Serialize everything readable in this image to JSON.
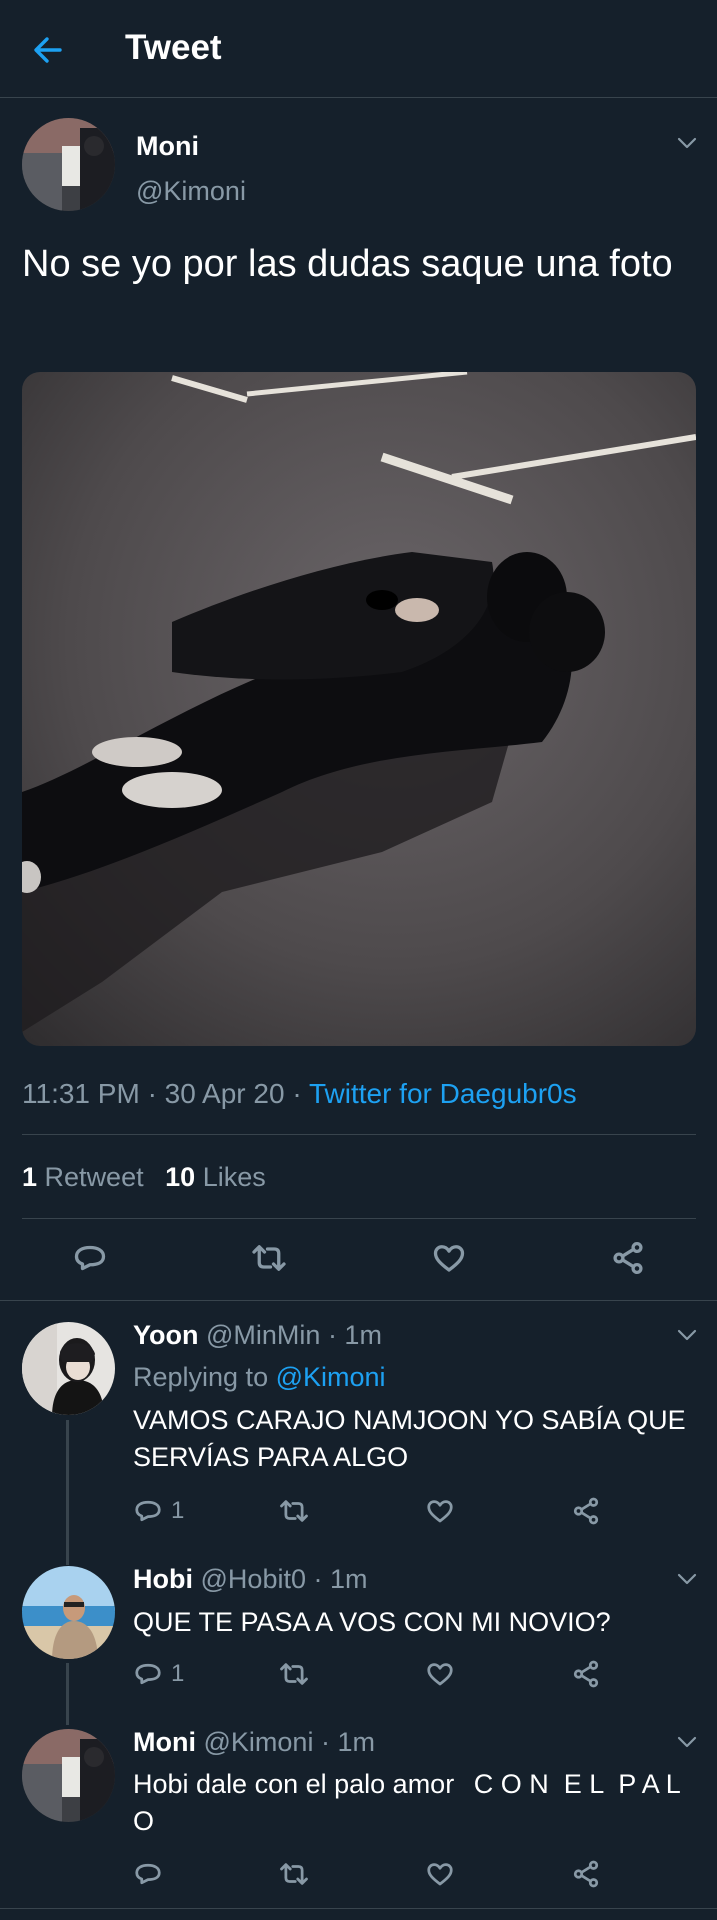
{
  "header": {
    "title": "Tweet"
  },
  "tweet": {
    "display_name": "Moni",
    "handle": "@Kimoni",
    "text": "No se yo por las dudas saque una foto",
    "time": "11:31 PM",
    "dot1": "·",
    "date": "30 Apr 20",
    "dot2": "·",
    "source": "Twitter for Daegubr0s",
    "retweet_count": "1",
    "retweet_label": "Retweet",
    "like_count": "10",
    "like_label": "Likes"
  },
  "replies": [
    {
      "display_name": "Yoon",
      "handle": "@MinMin",
      "time": "· 1m",
      "replying_prefix": "Replying to",
      "replying_handle": "@Kimoni",
      "text": "VAMOS CARAJO NAMJOON YO SABÍA QUE SERVÍAS PARA ALGO",
      "reply_count": "1"
    },
    {
      "display_name": "Hobi",
      "handle": "@Hobit0",
      "time": "· 1m",
      "text": "QUE TE PASA A VOS CON MI NOVIO?",
      "reply_count": "1"
    },
    {
      "display_name": "Moni",
      "handle": "@Kimoni",
      "time": "· 1m",
      "text": "Hobi dale con el palo amor",
      "text_spaced": "C O N  E L  P A L O"
    }
  ],
  "colors": {
    "background": "#15202b",
    "separator": "#38444d",
    "secondary_text": "#8899a6",
    "accent": "#1da1f2"
  },
  "icons": [
    "back-arrow-icon",
    "chevron-down-icon",
    "reply-icon",
    "retweet-icon",
    "like-icon",
    "share-icon"
  ]
}
